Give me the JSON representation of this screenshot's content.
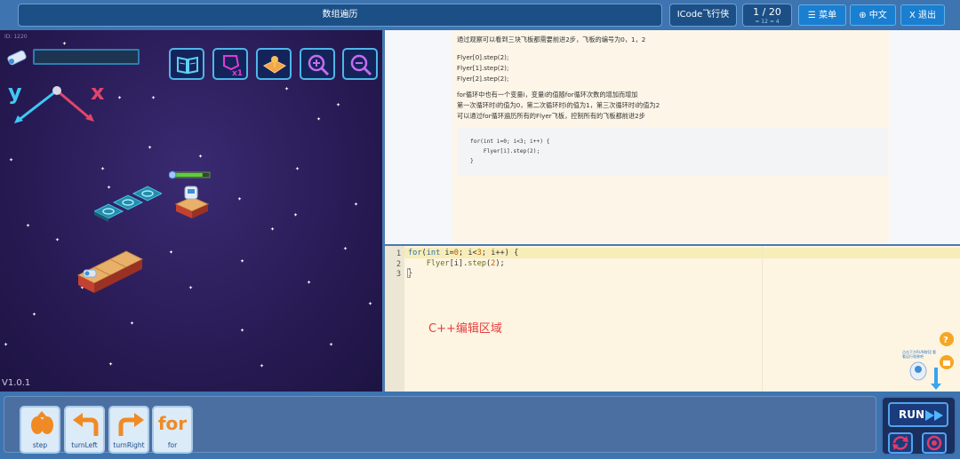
{
  "header": {
    "title": "数组遍历",
    "game_name": "ICode飞行侠",
    "level": "1 / 20",
    "level_sub": "≈ 12    ≈ 4",
    "menu_label": "☰ 菜单",
    "lang_label": "⊕ 中文",
    "exit_label": "X 退出"
  },
  "game": {
    "id_label": "ID: 1220",
    "version": "V1.0.1",
    "axis_x": "x",
    "axis_y": "y",
    "tools": [
      "book-icon",
      "clear-icon",
      "map-icon",
      "zoom-in-icon",
      "zoom-out-icon"
    ],
    "health_fill": 0.8
  },
  "doc": {
    "lines": [
      "通过观察可以看到三块飞板都需要前进2步，飞板的编号为0，1，2",
      "Flyer[0].step(2);",
      "Flyer[1].step(2);",
      "Flyer[2].step(2);",
      "for循环中也有一个变量i，变量i的值随for循环次数的增加而增加",
      "第一次循环时i的值为0，第二次循环时i的值为1，第三次循环时i的值为2",
      "可以通过for循环遍历所有的Flyer飞板，控制所有的飞板都前进2步"
    ],
    "code": [
      "for(int i=0; i<3; i++) {",
      "    Flyer[i].step(2);",
      "}"
    ]
  },
  "editor": {
    "line_numbers": [
      "1",
      "2",
      "3"
    ],
    "label": "C++编辑区域",
    "helper_text": "点击下方RUN按钮 看看运行效果吧"
  },
  "commands": [
    {
      "label": "step",
      "icon": "step-icon"
    },
    {
      "label": "turnLeft",
      "icon": "turn-left-icon"
    },
    {
      "label": "turnRight",
      "icon": "turn-right-icon"
    },
    {
      "label": "for",
      "icon": "for-icon",
      "icon_text": "for"
    }
  ],
  "run": {
    "label": "RUN"
  },
  "colors": {
    "accent": "#1a7fd0",
    "game_bg": "#2a1d5a",
    "editor_bg": "#fdf5e2",
    "label_red": "#e64040"
  }
}
